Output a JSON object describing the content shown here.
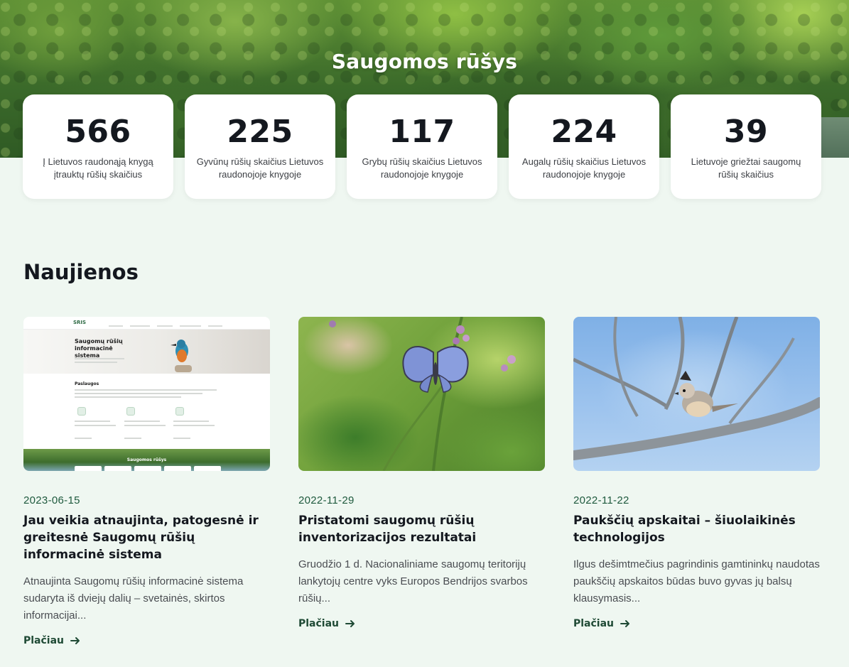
{
  "hero": {
    "title": "Saugomos rūšys"
  },
  "stats": [
    {
      "value": "566",
      "label": "Į Lietuvos raudonąją knygą įtrauktų rūšių skaičius"
    },
    {
      "value": "225",
      "label": "Gyvūnų rūšių skaičius Lietuvos raudonojoje knygoje"
    },
    {
      "value": "117",
      "label": "Grybų rūšių skaičius Lietuvos raudonojoje knygoje"
    },
    {
      "value": "224",
      "label": "Augalų rūšių skaičius Lietuvos raudonojoje knygoje"
    },
    {
      "value": "39",
      "label": "Lietuvoje griežtai saugomų rūšių skaičius"
    }
  ],
  "news": {
    "title": "Naujienos",
    "more_label": "Plačiau",
    "items": [
      {
        "date": "2023-06-15",
        "title": "Jau veikia atnaujinta, patogesnė ir greitesnė Saugomų rūšių informacinė sistema",
        "excerpt": "Atnaujinta Saugomų rūšių informacinė sistema sudaryta iš dviejų dalių – svetainės, skirtos informacijai...",
        "image": {
          "logo": "SRIS",
          "heading": "Saugomų rūšių informacinė sistema",
          "section": "Paslaugos",
          "footer_title": "Saugomos rūšys"
        }
      },
      {
        "date": "2022-11-29",
        "title": "Pristatomi saugomų rūšių inventorizacijos rezultatai",
        "excerpt": "Gruodžio 1 d. Nacionaliniame saugomų teritorijų lankytojų centre vyks Europos Bendrijos svarbos rūšių..."
      },
      {
        "date": "2022-11-22",
        "title": "Paukščių apskaitai – šiuolaikinės technologijos",
        "excerpt": "Ilgus dešimtmečius pagrindinis gamtininkų naudotas paukščių apskaitos būdas buvo gyvas jų balsų klausymasis..."
      }
    ]
  },
  "colors": {
    "page_bg": "#eff7f1",
    "accent_green": "#1f5a3e",
    "heading": "#14181f"
  }
}
